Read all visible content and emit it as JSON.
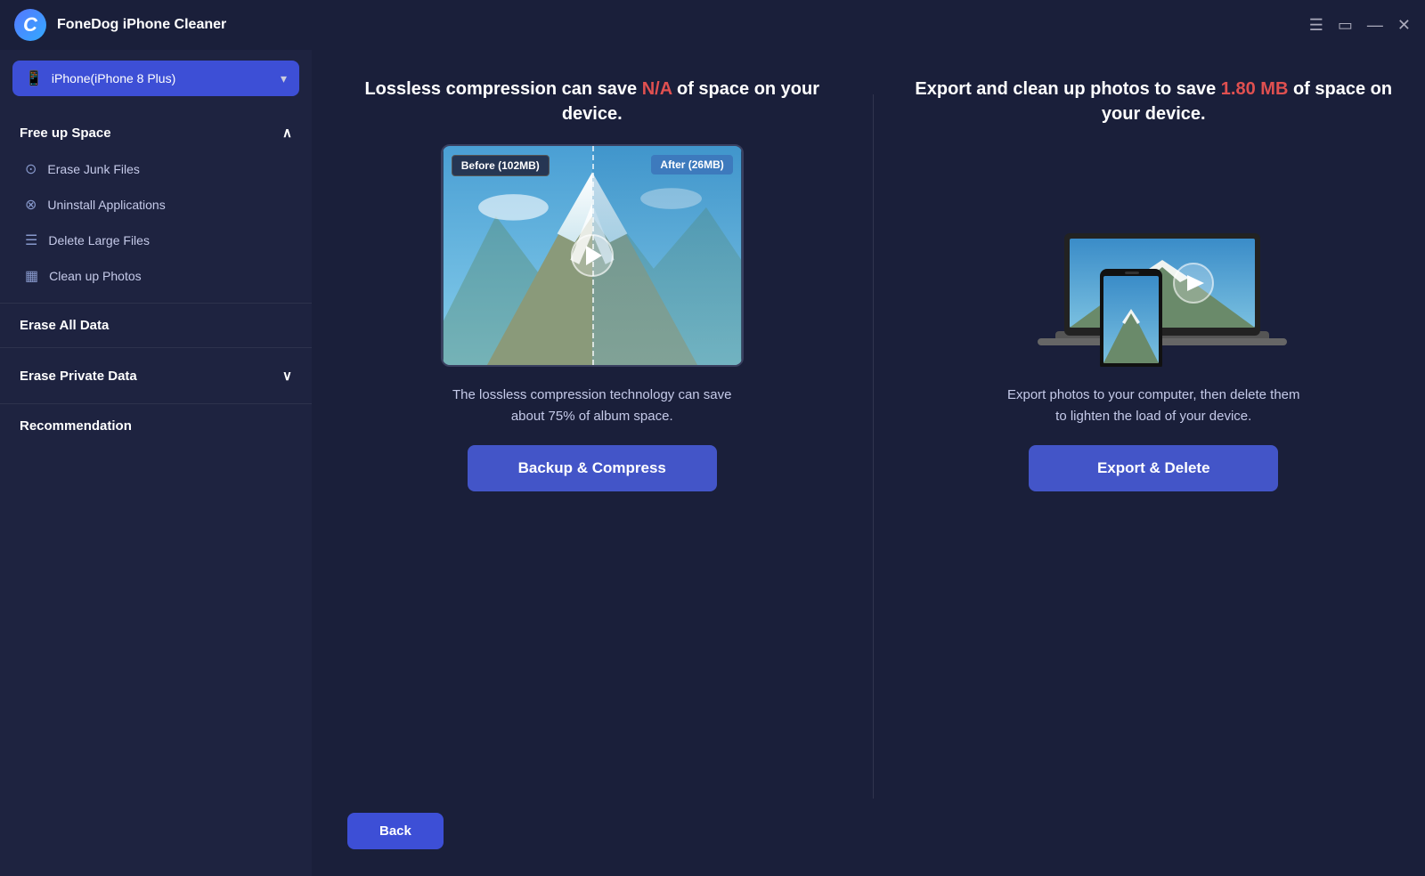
{
  "titleBar": {
    "appName": "FoneDog iPhone Cleaner",
    "controls": {
      "menu": "☰",
      "chat": "▭",
      "minimize": "—",
      "close": "✕"
    }
  },
  "deviceSelector": {
    "label": "iPhone(iPhone 8 Plus)",
    "icon": "📱"
  },
  "sidebar": {
    "sections": [
      {
        "id": "free-space",
        "header": "Free up Space",
        "collapsible": true,
        "expanded": true,
        "items": [
          {
            "id": "erase-junk",
            "label": "Erase Junk Files",
            "icon": "⊙"
          },
          {
            "id": "uninstall-apps",
            "label": "Uninstall Applications",
            "icon": "⊗"
          },
          {
            "id": "delete-large",
            "label": "Delete Large Files",
            "icon": "☰"
          },
          {
            "id": "clean-photos",
            "label": "Clean up Photos",
            "icon": "▦"
          }
        ]
      },
      {
        "id": "erase-all",
        "header": "Erase All Data",
        "collapsible": false,
        "solo": true
      },
      {
        "id": "erase-private",
        "header": "Erase Private Data",
        "collapsible": true,
        "expanded": false
      },
      {
        "id": "recommendation",
        "header": "Recommendation",
        "collapsible": false,
        "solo": true
      }
    ]
  },
  "cards": [
    {
      "id": "compress",
      "titleParts": [
        {
          "text": "Lossless compression can save ",
          "highlight": false
        },
        {
          "text": "N/A",
          "highlight": true
        },
        {
          "text": " of space on your device.",
          "highlight": false
        }
      ],
      "titleFull": "Lossless compression can save N/A of space on your device.",
      "beforeLabel": "Before (102MB)",
      "afterLabel": "After (26MB)",
      "description": "The lossless compression technology can save about 75% of album space.",
      "buttonLabel": "Backup & Compress"
    },
    {
      "id": "export",
      "titleParts": [
        {
          "text": "Export and clean up photos to save ",
          "highlight": false
        },
        {
          "text": "1.80 MB",
          "highlight": true
        },
        {
          "text": " of space on your device.",
          "highlight": false
        }
      ],
      "titleFull": "Export and clean up photos to save 1.80 MB of space on your device.",
      "description": "Export photos to your computer, then delete them to lighten the load of your device.",
      "buttonLabel": "Export & Delete"
    }
  ],
  "bottomBar": {
    "backLabel": "Back"
  }
}
